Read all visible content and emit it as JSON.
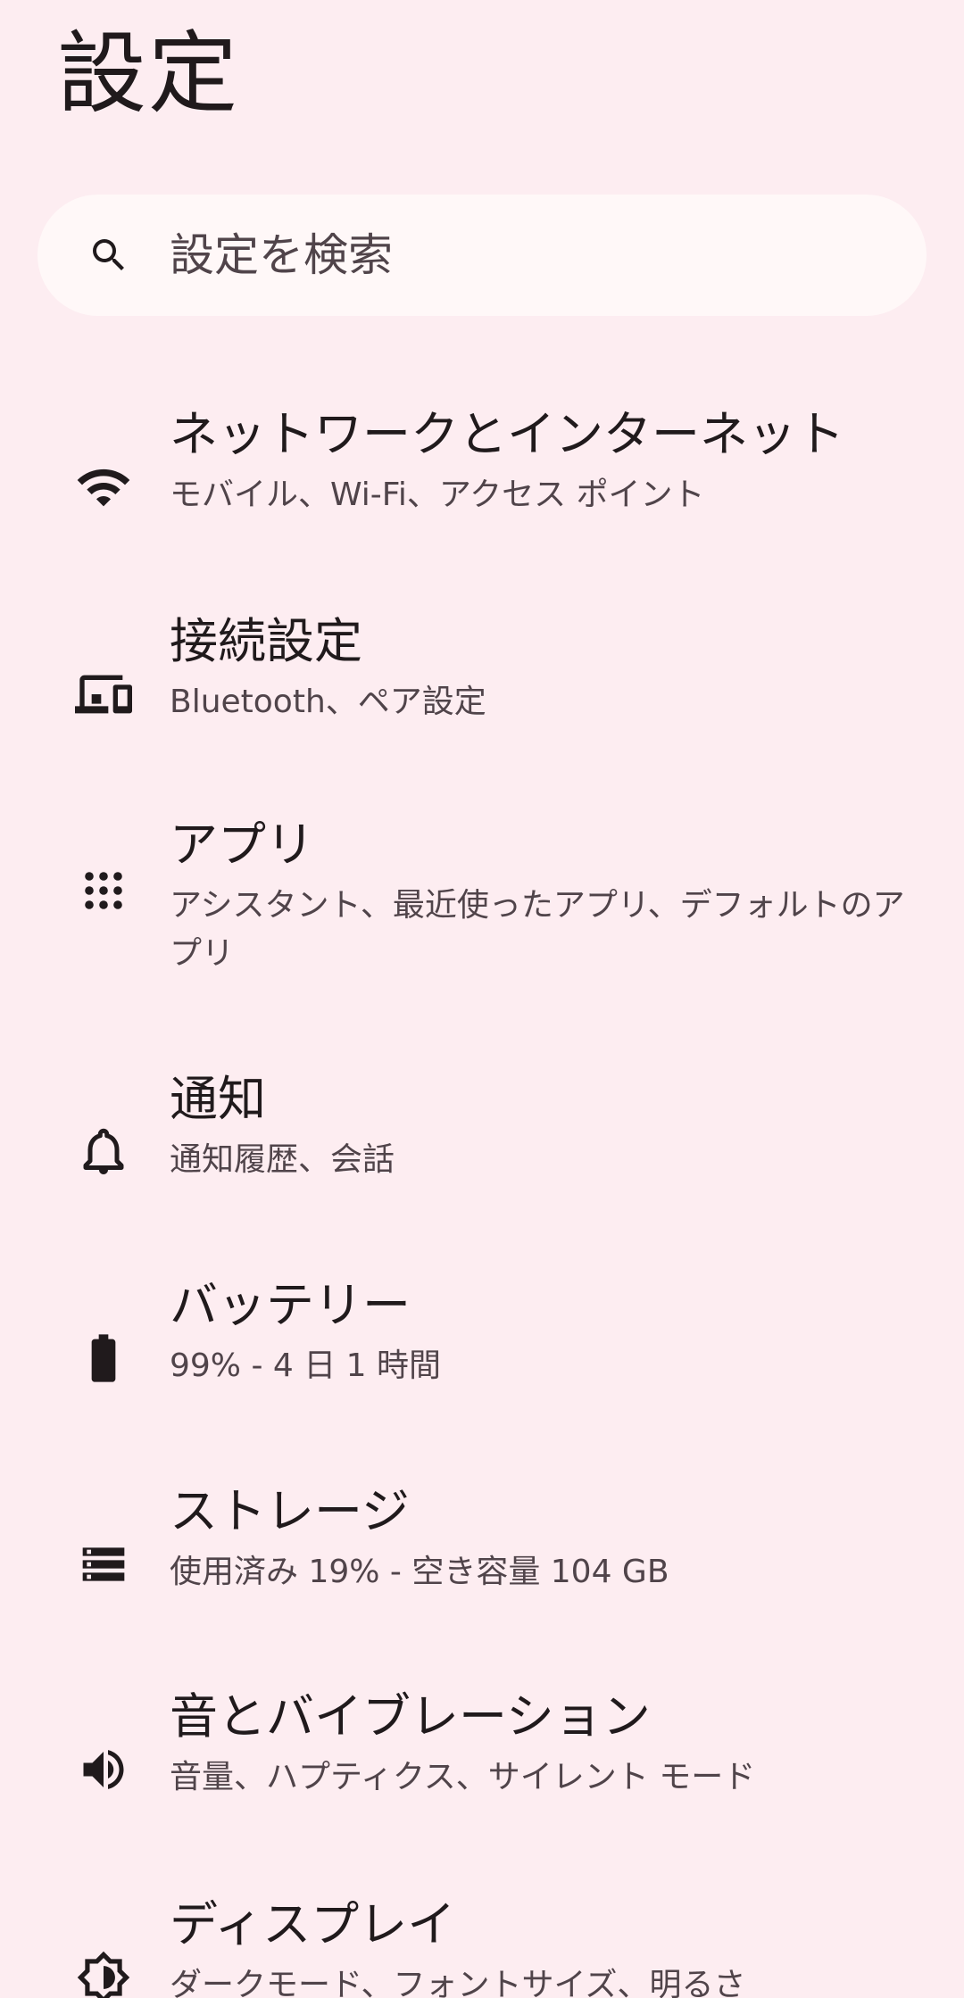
{
  "header": {
    "title": "設定"
  },
  "search": {
    "placeholder": "設定を検索",
    "icon": "search-icon"
  },
  "items": [
    {
      "key": "network",
      "icon": "wifi-icon",
      "title": "ネットワークとインターネット",
      "subtitle": "モバイル、Wi‑Fi、アクセス ポイント"
    },
    {
      "key": "connected",
      "icon": "connected-devices-icon",
      "title": "接続設定",
      "subtitle": "Bluetooth、ペア設定"
    },
    {
      "key": "apps",
      "icon": "apps-grid-icon",
      "title": "アプリ",
      "subtitle": "アシスタント、最近使ったアプリ、デフォルトのアプリ"
    },
    {
      "key": "notifications",
      "icon": "bell-icon",
      "title": "通知",
      "subtitle": "通知履歴、会話"
    },
    {
      "key": "battery",
      "icon": "battery-icon",
      "title": "バッテリー",
      "subtitle": "99% - 4 日 1 時間"
    },
    {
      "key": "storage",
      "icon": "storage-icon",
      "title": "ストレージ",
      "subtitle": "使用済み 19% - 空き容量 104 GB"
    },
    {
      "key": "sound",
      "icon": "speaker-icon",
      "title": "音とバイブレーション",
      "subtitle": "音量、ハプティクス、サイレント モード"
    },
    {
      "key": "display",
      "icon": "brightness-icon",
      "title": "ディスプレイ",
      "subtitle": "ダークモード、フォントサイズ、明るさ"
    }
  ],
  "colors": {
    "background": "#fdedf1",
    "search_bg": "#fff8f8",
    "text_primary": "#201a1c",
    "text_secondary": "#50444a"
  }
}
